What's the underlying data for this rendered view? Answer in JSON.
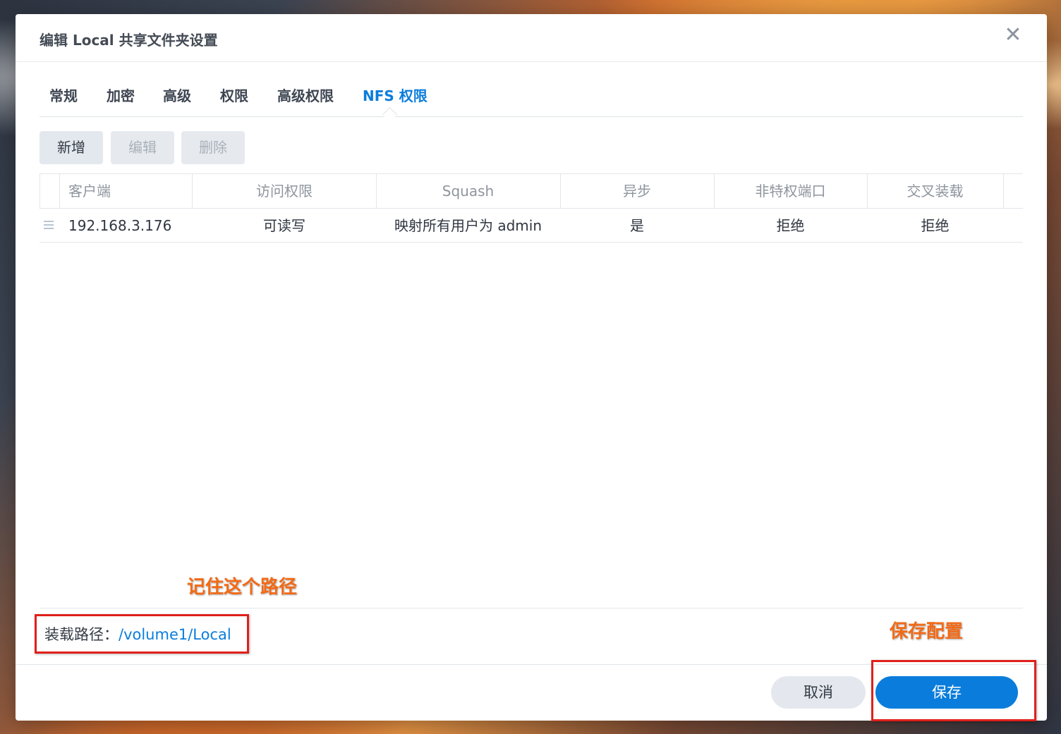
{
  "dialog": {
    "title": "编辑 Local 共享文件夹设置",
    "close_glyph": "✕"
  },
  "tabs": [
    {
      "label": "常规"
    },
    {
      "label": "加密"
    },
    {
      "label": "高级"
    },
    {
      "label": "权限"
    },
    {
      "label": "高级权限"
    },
    {
      "label": "NFS 权限",
      "active": true
    }
  ],
  "toolbar": {
    "add_label": "新增",
    "edit_label": "编辑",
    "delete_label": "删除"
  },
  "grid": {
    "columns": [
      "客户端",
      "访问权限",
      "Squash",
      "异步",
      "非特权端口",
      "交叉装载"
    ],
    "rows": [
      {
        "client": "192.168.3.176",
        "access": "可读写",
        "squash": "映射所有用户为 admin",
        "async": "是",
        "nonpriv_port": "拒绝",
        "cross_mount": "拒绝"
      }
    ]
  },
  "annotations": {
    "remember_path": "记住这个路径",
    "save_config": "保存配置",
    "color": "#f26a16",
    "box_color": "#e0201b"
  },
  "mount": {
    "label": "装载路径：",
    "path": "/volume1/Local"
  },
  "footer": {
    "cancel_label": "取消",
    "save_label": "保存"
  },
  "colors": {
    "accent": "#0a7ddc"
  }
}
